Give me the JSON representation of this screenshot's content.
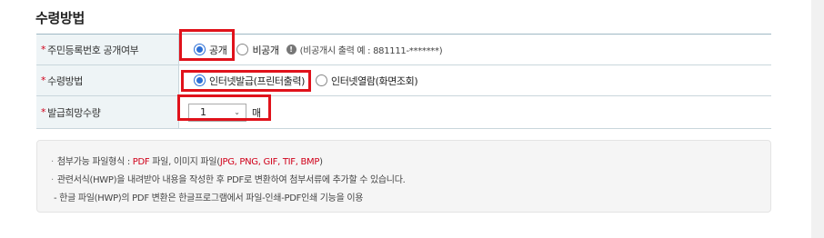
{
  "section_title": "수령방법",
  "rows": [
    {
      "label": "주민등록번호 공개여부",
      "options": [
        "공개",
        "비공개"
      ],
      "selected": "공개",
      "note": "(비공개시 출력 예 : 881111-*******)"
    },
    {
      "label": "수령방법",
      "options": [
        "인터넷발급(프린터출력)",
        "인터넷열람(화면조회)"
      ],
      "selected": "인터넷발급(프린터출력)"
    },
    {
      "label": "발급희망수량",
      "quantity": "1",
      "unit": "매"
    }
  ],
  "info": {
    "line1_prefix": "첨부가능 파일형식 : ",
    "line1_pdf": "PDF",
    "line1_mid": " 파일, 이미지 파일(",
    "line1_images": "JPG, PNG, GIF, TIF, BMP",
    "line1_suffix": ")",
    "line2": "관련서식(HWP)을 내려받아 내용을 작성한 후 PDF로 변환하여 첨부서류에 추가할 수 있습니다.",
    "line3": "- 한글 파일(HWP)의 PDF 변환은 한글프로그램에서 파일-인쇄-PDF인쇄 기능을 이용"
  },
  "colors": {
    "required_star": "#d0021b",
    "highlight": "#e0121b",
    "radio_selected": "#2b6fd6",
    "label_bg": "#eef4f6"
  },
  "icons": [
    "info-icon",
    "chevron-down-icon"
  ]
}
